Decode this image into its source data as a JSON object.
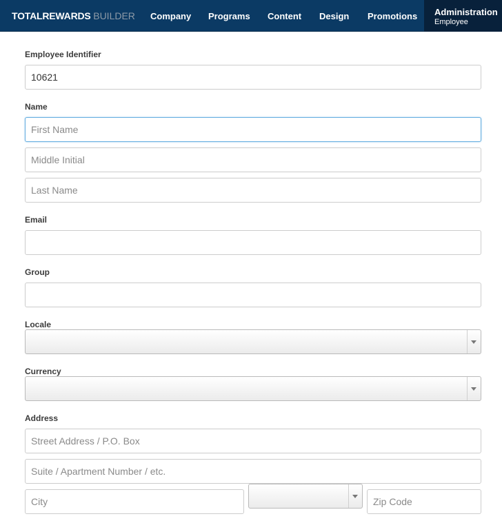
{
  "header": {
    "brand_primary": "TOTALREWARDS",
    "brand_secondary": "BUILDER",
    "nav": {
      "company": "Company",
      "programs": "Programs",
      "content": "Content",
      "design": "Design",
      "promotions": "Promotions"
    },
    "active": {
      "label": "Administration",
      "sublabel": "Employee"
    }
  },
  "form": {
    "employee_identifier": {
      "label": "Employee Identifier",
      "value": "10621"
    },
    "name": {
      "label": "Name",
      "first_placeholder": "First Name",
      "middle_placeholder": "Middle Initial",
      "last_placeholder": "Last Name"
    },
    "email": {
      "label": "Email",
      "value": ""
    },
    "group": {
      "label": "Group",
      "value": ""
    },
    "locale": {
      "label": "Locale",
      "selected": ""
    },
    "currency": {
      "label": "Currency",
      "selected": ""
    },
    "address": {
      "label": "Address",
      "street_placeholder": "Street Address / P.O. Box",
      "suite_placeholder": "Suite / Apartment Number / etc.",
      "city_placeholder": "City",
      "state_selected": "",
      "zip_placeholder": "Zip Code"
    }
  },
  "colors": {
    "navbar": "#0b3a64",
    "navbar_active": "#08213b",
    "brand_secondary": "#8d9aa7",
    "focus_border": "#66aee0"
  }
}
